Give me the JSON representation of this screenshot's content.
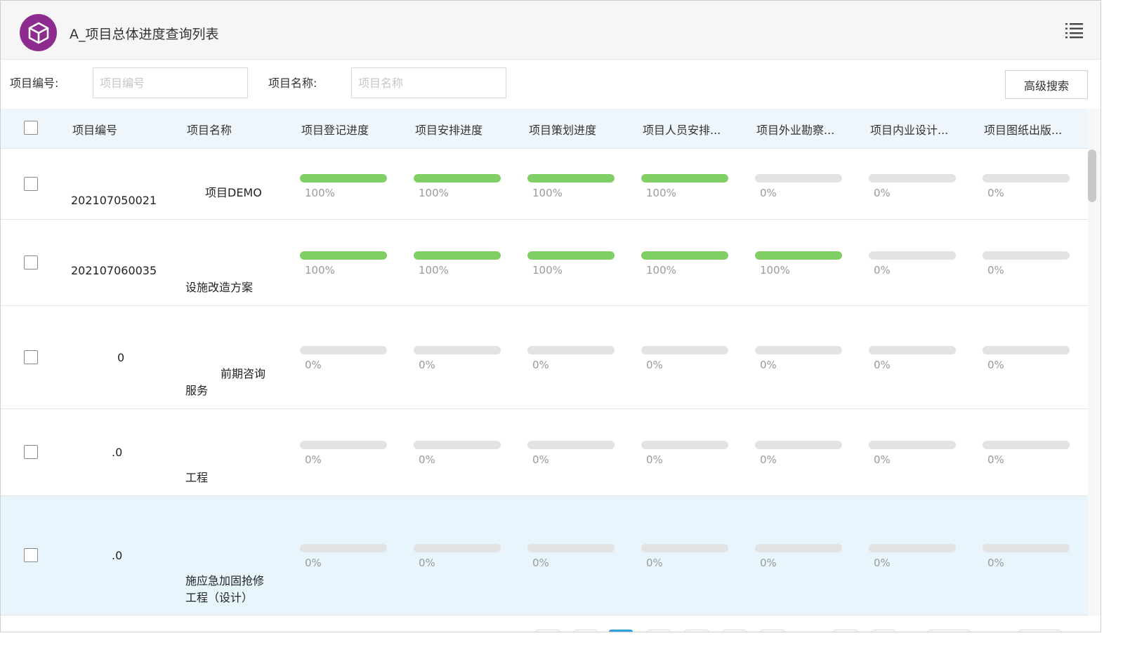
{
  "app": {
    "title": "A_项目总体进度查询列表",
    "logo_icon": "cube-icon",
    "menu_icon": "list-menu-icon",
    "brand_color": "#8e2b8e"
  },
  "search": {
    "code_label": "项目编号:",
    "code_placeholder": "项目编号",
    "name_label": "项目名称:",
    "name_placeholder": "项目名称",
    "advanced_label": "高级搜索"
  },
  "table": {
    "columns": [
      "项目编号",
      "项目名称",
      "项目登记进度",
      "项目安排进度",
      "项目策划进度",
      "项目人员安排...",
      "项目外业勘察...",
      "项目内业设计...",
      "项目图纸出版..."
    ],
    "progress_color": "#7fcf64",
    "rows": [
      {
        "id": "202107050021",
        "name": [
          "项目DEMO"
        ],
        "progress": [
          1,
          1,
          1,
          1,
          0,
          0,
          0
        ],
        "labels": [
          "100%",
          "100%",
          "100%",
          "100%",
          "0%",
          "0%",
          "0%"
        ]
      },
      {
        "id": "202107060035",
        "name": [
          "设施改造方案"
        ],
        "progress": [
          1,
          1,
          1,
          1,
          1,
          0,
          0
        ],
        "labels": [
          "100%",
          "100%",
          "100%",
          "100%",
          "100%",
          "0%",
          "0%"
        ]
      },
      {
        "id": "0",
        "name": [
          "前期咨询",
          "服务"
        ],
        "progress": [
          0,
          0,
          0,
          0,
          0,
          0,
          0
        ],
        "labels": [
          "0%",
          "0%",
          "0%",
          "0%",
          "0%",
          "0%",
          "0%"
        ]
      },
      {
        "id": ".0",
        "name": [
          "工程"
        ],
        "progress": [
          0,
          0,
          0,
          0,
          0,
          0,
          0
        ],
        "labels": [
          "0%",
          "0%",
          "0%",
          "0%",
          "0%",
          "0%",
          "0%"
        ]
      },
      {
        "id": ".0",
        "name": [
          "施应急加固抢修",
          "工程（设计）"
        ],
        "progress": [
          0,
          0,
          0,
          0,
          0,
          0,
          0
        ],
        "labels": [
          "0%",
          "0%",
          "0%",
          "0%",
          "0%",
          "0%",
          "0%"
        ],
        "highlighted": true
      }
    ]
  },
  "pagination": {
    "active_page": 3
  }
}
